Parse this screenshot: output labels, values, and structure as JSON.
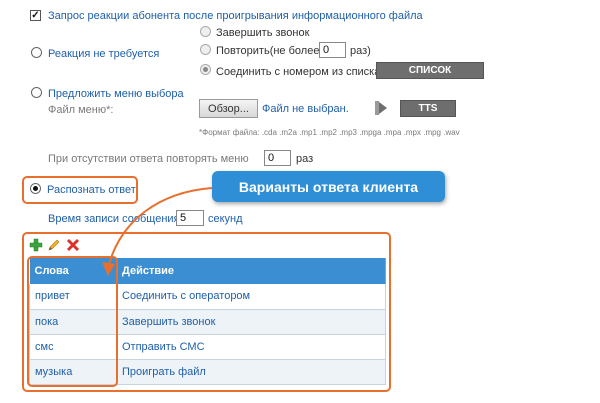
{
  "settings": {
    "request_reaction_label": "Запрос реакции абонента после проигрывания информационного файла",
    "no_reaction_label": "Реакция не требуется",
    "end_call_label": "Завершить звонок",
    "repeat_label": "Повторить(не более",
    "repeat_value": "0",
    "repeat_unit": "раз)",
    "connect_label": "Соединить с номером из списка",
    "list_button": "СПИСОК",
    "offer_menu_label": "Предложить меню выбора",
    "menu_file_label": "Файл меню*:",
    "browse_button": "Обзор...",
    "file_status": "Файл не выбран.",
    "tts_button": "TTS",
    "formats_note": "*Формат файла: .cda .m2a .mp1 .mp2 .mp3 .mpga .mpa .mpx .mpg .wav",
    "no_answer_label": "При отсутствии ответа повторять меню",
    "no_answer_value": "0",
    "no_answer_unit": "раз",
    "recognize_label": "Распознать ответ",
    "record_time_label": "Время записи сообщения",
    "record_time_value": "5",
    "record_time_unit": "секунд"
  },
  "tooltip": "Варианты ответа клиента",
  "table": {
    "headers": [
      "Слова",
      "Действие"
    ],
    "rows": [
      [
        "привет",
        "Соединить с оператором"
      ],
      [
        "пока",
        "Завершить звонок"
      ],
      [
        "смс",
        "Отправить СМС"
      ],
      [
        "музыка",
        "Проиграть файл"
      ]
    ]
  },
  "colors": {
    "accent_orange": "#e8702e",
    "header_blue": "#3b8ed1",
    "tooltip_blue": "#2f8fd6",
    "link_blue": "#1f5fa8"
  },
  "icons": [
    "add-icon",
    "edit-icon",
    "delete-icon",
    "play-icon"
  ]
}
